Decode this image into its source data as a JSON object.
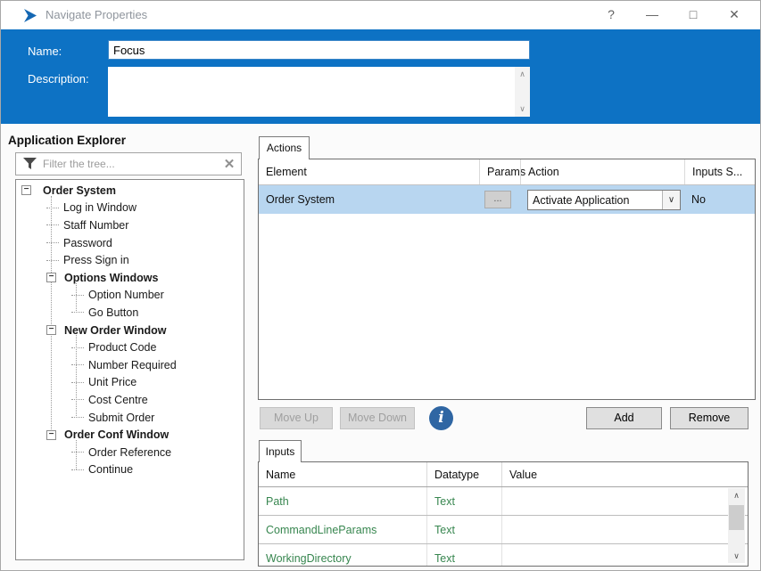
{
  "window": {
    "title": "Navigate Properties"
  },
  "icons": {
    "help": "?",
    "minimize": "—",
    "maximize": "□",
    "close": "✕",
    "collapse": "−",
    "filter_clear": "✕",
    "scroll_up": "∧",
    "scroll_down": "∨",
    "dropdown": "∨",
    "info": "i"
  },
  "band": {
    "name_label": "Name:",
    "name_value": "Focus",
    "description_label": "Description:",
    "description_value": ""
  },
  "explorer": {
    "title": "Application Explorer",
    "filter_placeholder": "Filter the tree...",
    "tree": [
      {
        "label": "Order System",
        "level": 0,
        "bold": true,
        "expandable": true
      },
      {
        "label": "Log in Window",
        "level": 1,
        "bold": false,
        "expandable": false
      },
      {
        "label": "Staff Number",
        "level": 1,
        "bold": false,
        "expandable": false
      },
      {
        "label": "Password",
        "level": 1,
        "bold": false,
        "expandable": false
      },
      {
        "label": "Press Sign in",
        "level": 1,
        "bold": false,
        "expandable": false
      },
      {
        "label": "Options Windows",
        "level": 1,
        "bold": true,
        "expandable": true
      },
      {
        "label": "Option Number",
        "level": 2,
        "bold": false,
        "expandable": false
      },
      {
        "label": "Go Button",
        "level": 2,
        "bold": false,
        "expandable": false
      },
      {
        "label": "New Order Window",
        "level": 1,
        "bold": true,
        "expandable": true
      },
      {
        "label": "Product Code",
        "level": 2,
        "bold": false,
        "expandable": false
      },
      {
        "label": "Number Required",
        "level": 2,
        "bold": false,
        "expandable": false
      },
      {
        "label": "Unit Price",
        "level": 2,
        "bold": false,
        "expandable": false
      },
      {
        "label": "Cost Centre",
        "level": 2,
        "bold": false,
        "expandable": false
      },
      {
        "label": "Submit Order",
        "level": 2,
        "bold": false,
        "expandable": false
      },
      {
        "label": "Order Conf Window",
        "level": 1,
        "bold": true,
        "expandable": true
      },
      {
        "label": "Order Reference",
        "level": 2,
        "bold": false,
        "expandable": false
      },
      {
        "label": "Continue",
        "level": 2,
        "bold": false,
        "expandable": false
      }
    ]
  },
  "actions": {
    "tab_label": "Actions",
    "columns": [
      "Element",
      "Params",
      "Action",
      "Inputs S..."
    ],
    "rows": [
      {
        "element": "Order System",
        "params": "...",
        "action": "Activate Application",
        "inputs_set": "No"
      }
    ],
    "buttons": {
      "move_up": "Move Up",
      "move_down": "Move Down",
      "add": "Add",
      "remove": "Remove"
    }
  },
  "inputs": {
    "tab_label": "Inputs",
    "columns": [
      "Name",
      "Datatype",
      "Value"
    ],
    "rows": [
      {
        "name": "Path",
        "datatype": "Text",
        "value": ""
      },
      {
        "name": "CommandLineParams",
        "datatype": "Text",
        "value": ""
      },
      {
        "name": "WorkingDirectory",
        "datatype": "Text",
        "value": ""
      }
    ]
  },
  "colors": {
    "accent_blue": "#0d72c4",
    "selection_blue": "#b8d6f0",
    "input_green": "#37864f",
    "info_icon_blue": "#2f66a3"
  }
}
